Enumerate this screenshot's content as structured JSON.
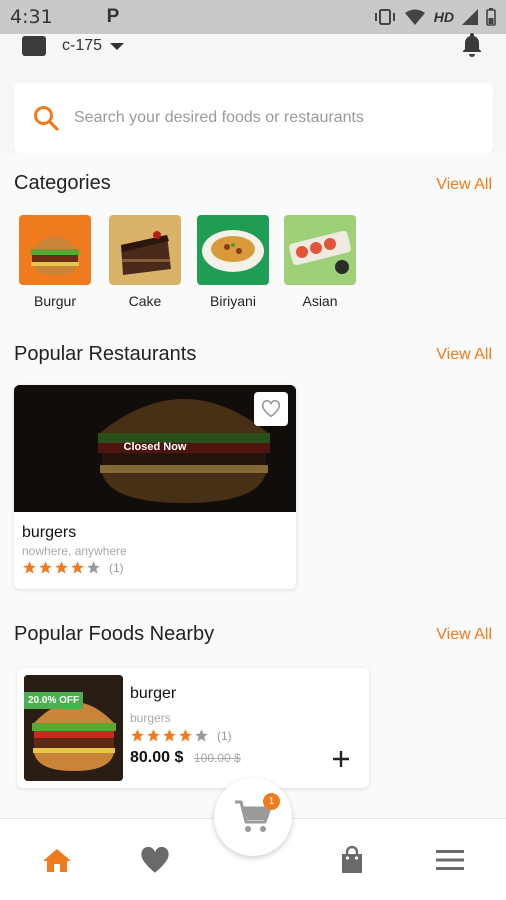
{
  "status_bar": {
    "time": "4:31",
    "app_letter": "P",
    "network": "HD"
  },
  "header": {
    "location": "c-175"
  },
  "search": {
    "placeholder": "Search your desired foods or restaurants"
  },
  "categories": {
    "title": "Categories",
    "view_all": "View All",
    "items": [
      {
        "label": "Burgur",
        "bg": "#f07b1c"
      },
      {
        "label": "Cake",
        "bg": "#d9b36a"
      },
      {
        "label": "Biriyani",
        "bg": "#1f9d55"
      },
      {
        "label": "Asian",
        "bg": "#9ed07a"
      }
    ]
  },
  "popular_restaurants": {
    "title": "Popular Restaurants",
    "view_all": "View All",
    "items": [
      {
        "status": "Closed Now",
        "name": "burgers",
        "address": "nowhere, anywhere",
        "rating": 4,
        "rating_count": "(1)"
      }
    ]
  },
  "popular_foods": {
    "title": "Popular Foods Nearby",
    "view_all": "View All",
    "items": [
      {
        "discount": "20.0% OFF",
        "name": "burger",
        "restaurant": "burgers",
        "rating": 4,
        "rating_count": "(1)",
        "price": "80.00 $",
        "old_price": "100.00 $"
      }
    ]
  },
  "bottom_nav": {
    "cart_count": "1",
    "active": "home"
  },
  "colors": {
    "accent": "#f07b1c",
    "discount": "#4caf50",
    "icon_inactive": "#6a6a6a"
  }
}
